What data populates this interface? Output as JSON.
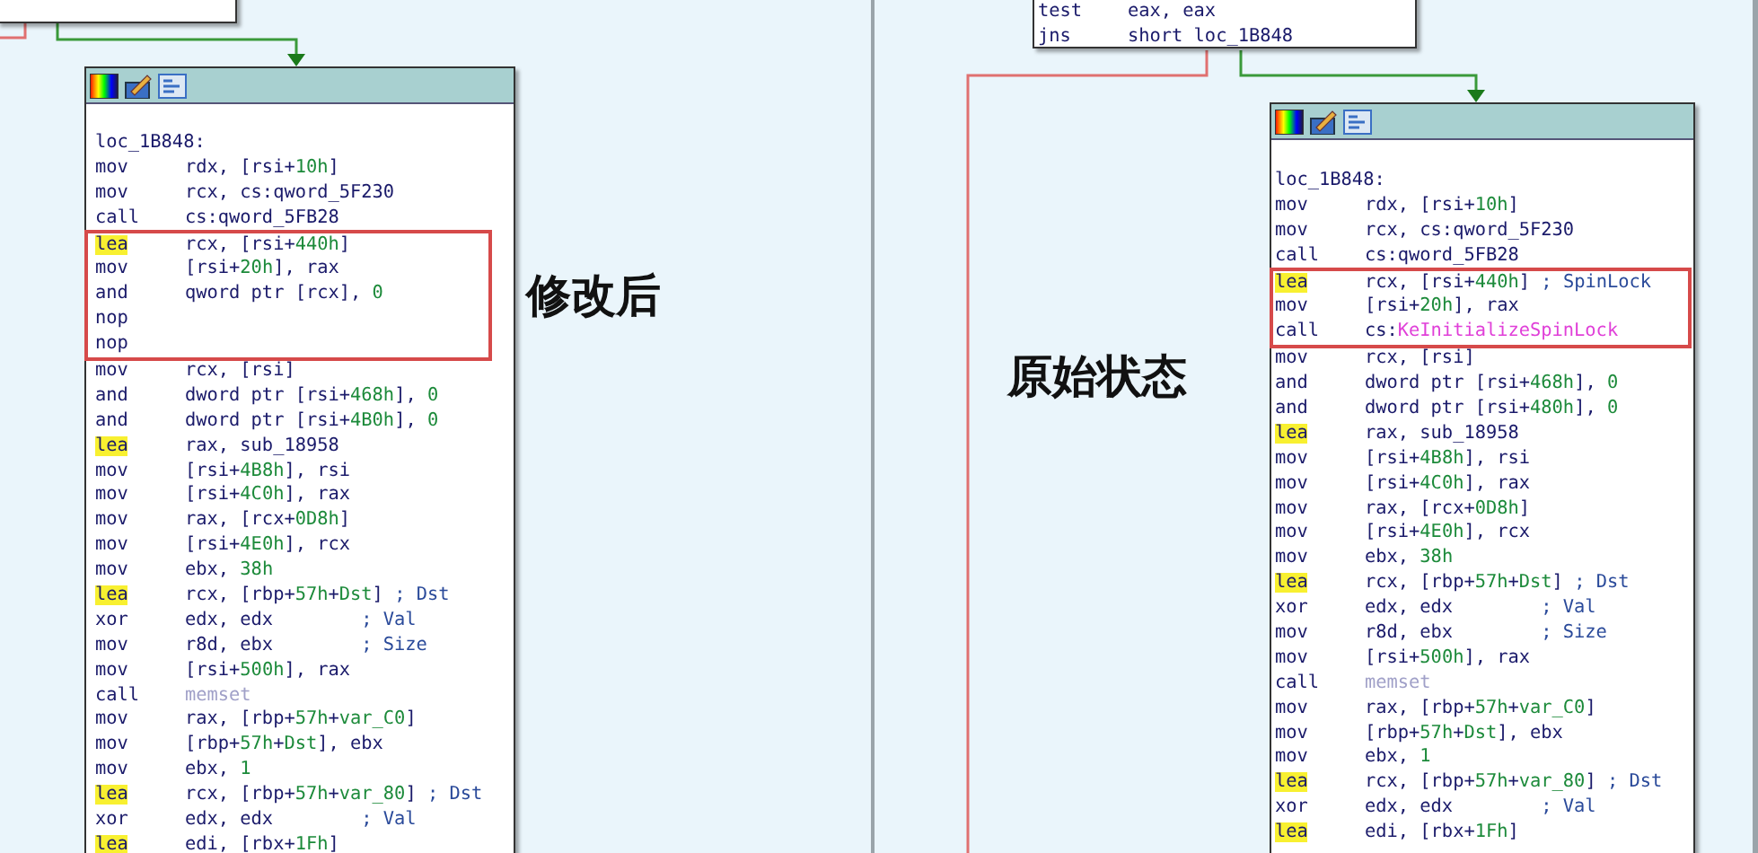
{
  "panels": [
    {
      "caption": "修改后",
      "block": {
        "label": "loc_1B848:",
        "groups": [
          {
            "boxed": false,
            "lines": [
              {
                "mnemonic": "mov",
                "highlighted": false,
                "operand": [
                  {
                    "text": "rdx, [rsi+"
                  },
                  {
                    "text": "10h",
                    "kind": "num"
                  },
                  {
                    "text": "]"
                  }
                ]
              },
              {
                "mnemonic": "mov",
                "highlighted": false,
                "operand": [
                  {
                    "text": "rcx, cs:qword_5F230"
                  }
                ]
              },
              {
                "mnemonic": "call",
                "highlighted": false,
                "operand": [
                  {
                    "text": "cs:qword_5FB28"
                  }
                ]
              }
            ]
          },
          {
            "boxed": true,
            "lines": [
              {
                "mnemonic": "lea",
                "highlighted": true,
                "operand": [
                  {
                    "text": "rcx, [rsi+"
                  },
                  {
                    "text": "440h",
                    "kind": "num"
                  },
                  {
                    "text": "]"
                  }
                ]
              },
              {
                "mnemonic": "mov",
                "highlighted": false,
                "operand": [
                  {
                    "text": "[rsi+"
                  },
                  {
                    "text": "20h",
                    "kind": "num"
                  },
                  {
                    "text": "], rax"
                  }
                ]
              },
              {
                "mnemonic": "and",
                "highlighted": false,
                "operand": [
                  {
                    "text": "qword ptr [rcx], "
                  },
                  {
                    "text": "0",
                    "kind": "num"
                  }
                ]
              },
              {
                "mnemonic": "nop",
                "highlighted": false
              },
              {
                "mnemonic": "nop",
                "highlighted": false
              }
            ]
          },
          {
            "boxed": false,
            "lines": [
              {
                "mnemonic": "mov",
                "highlighted": false,
                "operand": [
                  {
                    "text": "rcx, [rsi]"
                  }
                ]
              },
              {
                "mnemonic": "and",
                "highlighted": false,
                "operand": [
                  {
                    "text": "dword ptr [rsi+"
                  },
                  {
                    "text": "468h",
                    "kind": "num"
                  },
                  {
                    "text": "], "
                  },
                  {
                    "text": "0",
                    "kind": "num"
                  }
                ]
              },
              {
                "mnemonic": "and",
                "highlighted": false,
                "operand": [
                  {
                    "text": "dword ptr [rsi+"
                  },
                  {
                    "text": "4B0h",
                    "kind": "num"
                  },
                  {
                    "text": "], "
                  },
                  {
                    "text": "0",
                    "kind": "num"
                  }
                ]
              },
              {
                "mnemonic": "lea",
                "highlighted": true,
                "operand": [
                  {
                    "text": "rax, sub_18958"
                  }
                ]
              },
              {
                "mnemonic": "mov",
                "highlighted": false,
                "operand": [
                  {
                    "text": "[rsi+"
                  },
                  {
                    "text": "4B8h",
                    "kind": "num"
                  },
                  {
                    "text": "], rsi"
                  }
                ]
              },
              {
                "mnemonic": "mov",
                "highlighted": false,
                "operand": [
                  {
                    "text": "[rsi+"
                  },
                  {
                    "text": "4C0h",
                    "kind": "num"
                  },
                  {
                    "text": "], rax"
                  }
                ]
              },
              {
                "mnemonic": "mov",
                "highlighted": false,
                "operand": [
                  {
                    "text": "rax, [rcx+"
                  },
                  {
                    "text": "0D8h",
                    "kind": "num"
                  },
                  {
                    "text": "]"
                  }
                ]
              },
              {
                "mnemonic": "mov",
                "highlighted": false,
                "operand": [
                  {
                    "text": "[rsi+"
                  },
                  {
                    "text": "4E0h",
                    "kind": "num"
                  },
                  {
                    "text": "], rcx"
                  }
                ]
              },
              {
                "mnemonic": "mov",
                "highlighted": false,
                "operand": [
                  {
                    "text": "ebx, "
                  },
                  {
                    "text": "38h",
                    "kind": "num"
                  }
                ]
              },
              {
                "mnemonic": "lea",
                "highlighted": true,
                "operand": [
                  {
                    "text": "rcx, [rbp+"
                  },
                  {
                    "text": "57h",
                    "kind": "num"
                  },
                  {
                    "text": "+"
                  },
                  {
                    "text": "Dst",
                    "kind": "num"
                  },
                  {
                    "text": "] "
                  },
                  {
                    "text": "; Dst",
                    "kind": "comment"
                  }
                ]
              },
              {
                "mnemonic": "xor",
                "highlighted": false,
                "operand": [
                  {
                    "text": "edx, edx        "
                  },
                  {
                    "text": "; Val",
                    "kind": "comment"
                  }
                ]
              },
              {
                "mnemonic": "mov",
                "highlighted": false,
                "operand": [
                  {
                    "text": "r8d, ebx        "
                  },
                  {
                    "text": "; Size",
                    "kind": "comment"
                  }
                ]
              },
              {
                "mnemonic": "mov",
                "highlighted": false,
                "operand": [
                  {
                    "text": "[rsi+"
                  },
                  {
                    "text": "500h",
                    "kind": "num"
                  },
                  {
                    "text": "], rax"
                  }
                ]
              },
              {
                "mnemonic": "call",
                "highlighted": false,
                "operand": [
                  {
                    "text": "memset",
                    "kind": "extern"
                  }
                ]
              },
              {
                "mnemonic": "mov",
                "highlighted": false,
                "operand": [
                  {
                    "text": "rax, [rbp+"
                  },
                  {
                    "text": "57h",
                    "kind": "num"
                  },
                  {
                    "text": "+"
                  },
                  {
                    "text": "var_C0",
                    "kind": "num"
                  },
                  {
                    "text": "]"
                  }
                ]
              },
              {
                "mnemonic": "mov",
                "highlighted": false,
                "operand": [
                  {
                    "text": "[rbp+"
                  },
                  {
                    "text": "57h",
                    "kind": "num"
                  },
                  {
                    "text": "+"
                  },
                  {
                    "text": "Dst",
                    "kind": "num"
                  },
                  {
                    "text": "], ebx"
                  }
                ]
              },
              {
                "mnemonic": "mov",
                "highlighted": false,
                "operand": [
                  {
                    "text": "ebx, "
                  },
                  {
                    "text": "1",
                    "kind": "num"
                  }
                ]
              },
              {
                "mnemonic": "lea",
                "highlighted": true,
                "operand": [
                  {
                    "text": "rcx, [rbp+"
                  },
                  {
                    "text": "57h",
                    "kind": "num"
                  },
                  {
                    "text": "+"
                  },
                  {
                    "text": "var_80",
                    "kind": "num"
                  },
                  {
                    "text": "] "
                  },
                  {
                    "text": "; Dst",
                    "kind": "comment"
                  }
                ]
              },
              {
                "mnemonic": "xor",
                "highlighted": false,
                "operand": [
                  {
                    "text": "edx, edx        "
                  },
                  {
                    "text": "; Val",
                    "kind": "comment"
                  }
                ]
              },
              {
                "mnemonic": "lea",
                "highlighted": true,
                "operand": [
                  {
                    "text": "edi, [rbx+"
                  },
                  {
                    "text": "1Fh",
                    "kind": "num"
                  },
                  {
                    "text": "]"
                  }
                ]
              }
            ]
          }
        ]
      }
    },
    {
      "caption": "原始状态",
      "top_block": {
        "lines": [
          {
            "mnemonic": "test",
            "operand": [
              {
                "text": "eax, eax"
              }
            ]
          },
          {
            "mnemonic": "jns",
            "operand": [
              {
                "text": "short loc_1B848"
              }
            ]
          }
        ]
      },
      "block": {
        "label": "loc_1B848:",
        "groups": [
          {
            "boxed": false,
            "lines": [
              {
                "mnemonic": "mov",
                "highlighted": false,
                "operand": [
                  {
                    "text": "rdx, [rsi+"
                  },
                  {
                    "text": "10h",
                    "kind": "num"
                  },
                  {
                    "text": "]"
                  }
                ]
              },
              {
                "mnemonic": "mov",
                "highlighted": false,
                "operand": [
                  {
                    "text": "rcx, cs:qword_5F230"
                  }
                ]
              },
              {
                "mnemonic": "call",
                "highlighted": false,
                "operand": [
                  {
                    "text": "cs:qword_5FB28"
                  }
                ]
              }
            ]
          },
          {
            "boxed": true,
            "lines": [
              {
                "mnemonic": "lea",
                "highlighted": true,
                "operand": [
                  {
                    "text": "rcx, [rsi+"
                  },
                  {
                    "text": "440h",
                    "kind": "num"
                  },
                  {
                    "text": "] "
                  },
                  {
                    "text": "; SpinLock",
                    "kind": "comment"
                  }
                ]
              },
              {
                "mnemonic": "mov",
                "highlighted": false,
                "operand": [
                  {
                    "text": "[rsi+"
                  },
                  {
                    "text": "20h",
                    "kind": "num"
                  },
                  {
                    "text": "], rax"
                  }
                ]
              },
              {
                "mnemonic": "call",
                "highlighted": false,
                "operand": [
                  {
                    "text": "cs:"
                  },
                  {
                    "text": "KeInitializeSpinLock",
                    "kind": "import"
                  }
                ]
              }
            ]
          },
          {
            "boxed": false,
            "lines": [
              {
                "mnemonic": "mov",
                "highlighted": false,
                "operand": [
                  {
                    "text": "rcx, [rsi]"
                  }
                ]
              },
              {
                "mnemonic": "and",
                "highlighted": false,
                "operand": [
                  {
                    "text": "dword ptr [rsi+"
                  },
                  {
                    "text": "468h",
                    "kind": "num"
                  },
                  {
                    "text": "], "
                  },
                  {
                    "text": "0",
                    "kind": "num"
                  }
                ]
              },
              {
                "mnemonic": "and",
                "highlighted": false,
                "operand": [
                  {
                    "text": "dword ptr [rsi+"
                  },
                  {
                    "text": "480h",
                    "kind": "num"
                  },
                  {
                    "text": "], "
                  },
                  {
                    "text": "0",
                    "kind": "num"
                  }
                ]
              },
              {
                "mnemonic": "lea",
                "highlighted": true,
                "operand": [
                  {
                    "text": "rax, sub_18958"
                  }
                ]
              },
              {
                "mnemonic": "mov",
                "highlighted": false,
                "operand": [
                  {
                    "text": "[rsi+"
                  },
                  {
                    "text": "4B8h",
                    "kind": "num"
                  },
                  {
                    "text": "], rsi"
                  }
                ]
              },
              {
                "mnemonic": "mov",
                "highlighted": false,
                "operand": [
                  {
                    "text": "[rsi+"
                  },
                  {
                    "text": "4C0h",
                    "kind": "num"
                  },
                  {
                    "text": "], rax"
                  }
                ]
              },
              {
                "mnemonic": "mov",
                "highlighted": false,
                "operand": [
                  {
                    "text": "rax, [rcx+"
                  },
                  {
                    "text": "0D8h",
                    "kind": "num"
                  },
                  {
                    "text": "]"
                  }
                ]
              },
              {
                "mnemonic": "mov",
                "highlighted": false,
                "operand": [
                  {
                    "text": "[rsi+"
                  },
                  {
                    "text": "4E0h",
                    "kind": "num"
                  },
                  {
                    "text": "], rcx"
                  }
                ]
              },
              {
                "mnemonic": "mov",
                "highlighted": false,
                "operand": [
                  {
                    "text": "ebx, "
                  },
                  {
                    "text": "38h",
                    "kind": "num"
                  }
                ]
              },
              {
                "mnemonic": "lea",
                "highlighted": true,
                "operand": [
                  {
                    "text": "rcx, [rbp+"
                  },
                  {
                    "text": "57h",
                    "kind": "num"
                  },
                  {
                    "text": "+"
                  },
                  {
                    "text": "Dst",
                    "kind": "num"
                  },
                  {
                    "text": "] "
                  },
                  {
                    "text": "; Dst",
                    "kind": "comment"
                  }
                ]
              },
              {
                "mnemonic": "xor",
                "highlighted": false,
                "operand": [
                  {
                    "text": "edx, edx        "
                  },
                  {
                    "text": "; Val",
                    "kind": "comment"
                  }
                ]
              },
              {
                "mnemonic": "mov",
                "highlighted": false,
                "operand": [
                  {
                    "text": "r8d, ebx        "
                  },
                  {
                    "text": "; Size",
                    "kind": "comment"
                  }
                ]
              },
              {
                "mnemonic": "mov",
                "highlighted": false,
                "operand": [
                  {
                    "text": "[rsi+"
                  },
                  {
                    "text": "500h",
                    "kind": "num"
                  },
                  {
                    "text": "], rax"
                  }
                ]
              },
              {
                "mnemonic": "call",
                "highlighted": false,
                "operand": [
                  {
                    "text": "memset",
                    "kind": "extern"
                  }
                ]
              },
              {
                "mnemonic": "mov",
                "highlighted": false,
                "operand": [
                  {
                    "text": "rax, [rbp+"
                  },
                  {
                    "text": "57h",
                    "kind": "num"
                  },
                  {
                    "text": "+"
                  },
                  {
                    "text": "var_C0",
                    "kind": "num"
                  },
                  {
                    "text": "]"
                  }
                ]
              },
              {
                "mnemonic": "mov",
                "highlighted": false,
                "operand": [
                  {
                    "text": "[rbp+"
                  },
                  {
                    "text": "57h",
                    "kind": "num"
                  },
                  {
                    "text": "+"
                  },
                  {
                    "text": "Dst",
                    "kind": "num"
                  },
                  {
                    "text": "], ebx"
                  }
                ]
              },
              {
                "mnemonic": "mov",
                "highlighted": false,
                "operand": [
                  {
                    "text": "ebx, "
                  },
                  {
                    "text": "1",
                    "kind": "num"
                  }
                ]
              },
              {
                "mnemonic": "lea",
                "highlighted": true,
                "operand": [
                  {
                    "text": "rcx, [rbp+"
                  },
                  {
                    "text": "57h",
                    "kind": "num"
                  },
                  {
                    "text": "+"
                  },
                  {
                    "text": "var_80",
                    "kind": "num"
                  },
                  {
                    "text": "] "
                  },
                  {
                    "text": "; Dst",
                    "kind": "comment"
                  }
                ]
              },
              {
                "mnemonic": "xor",
                "highlighted": false,
                "operand": [
                  {
                    "text": "edx, edx        "
                  },
                  {
                    "text": "; Val",
                    "kind": "comment"
                  }
                ]
              },
              {
                "mnemonic": "lea",
                "highlighted": true,
                "operand": [
                  {
                    "text": "edi, [rbx+"
                  },
                  {
                    "text": "1Fh",
                    "kind": "num"
                  },
                  {
                    "text": "]"
                  }
                ]
              }
            ]
          }
        ]
      }
    }
  ]
}
